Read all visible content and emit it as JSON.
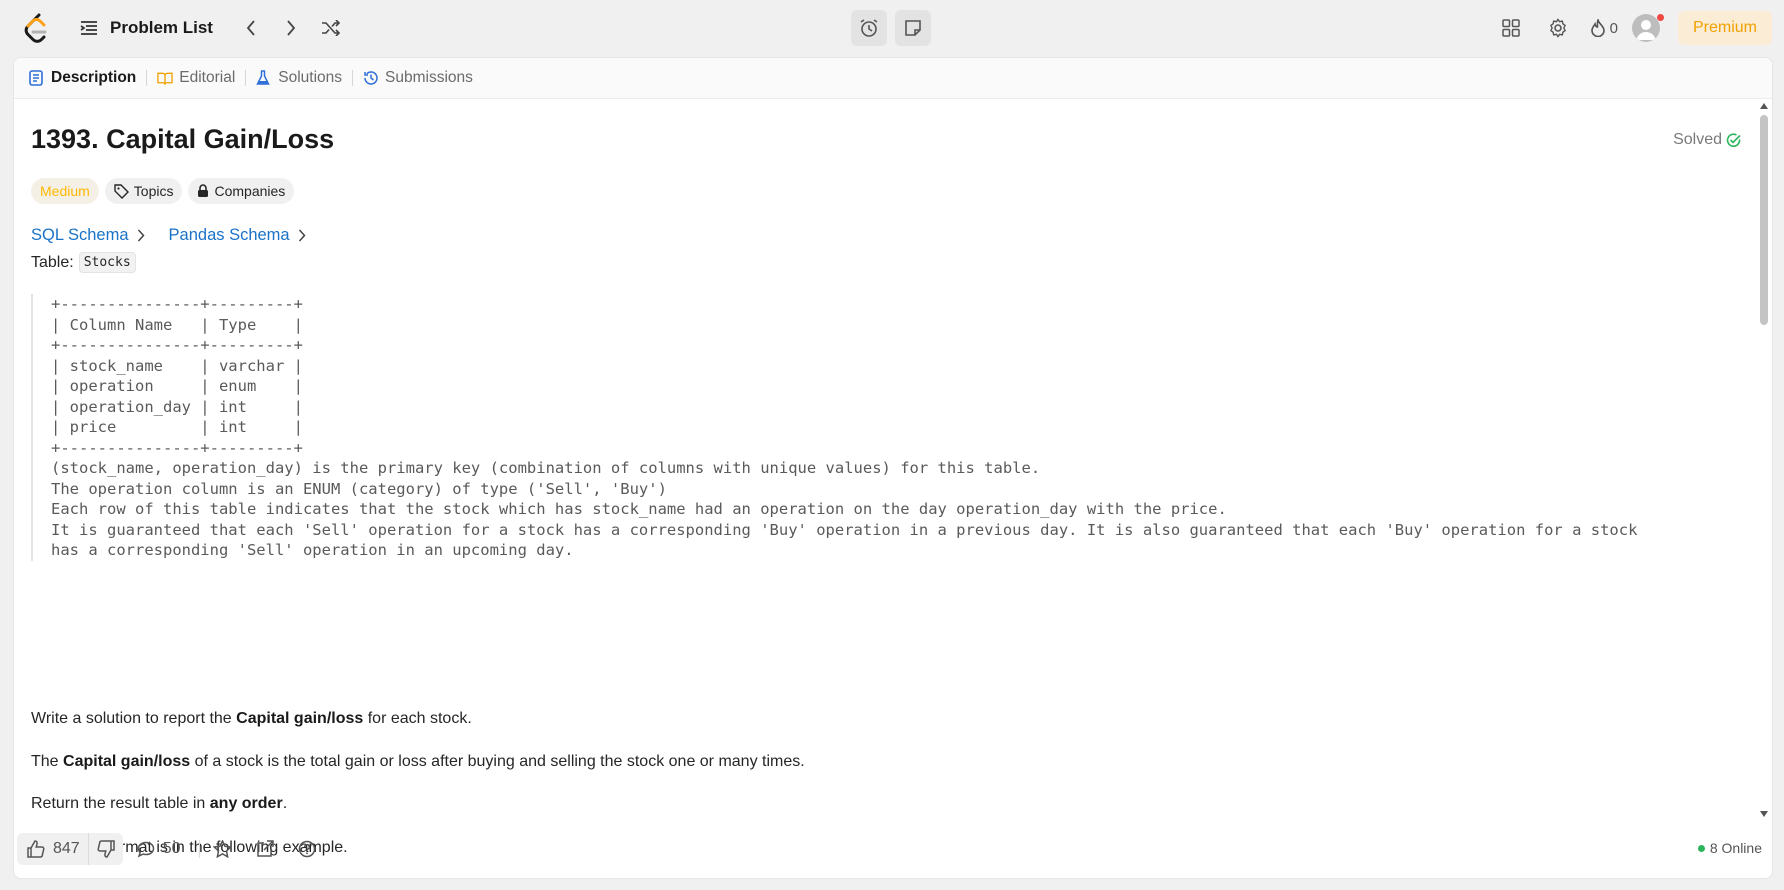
{
  "nav": {
    "problem_list_label": "Problem List",
    "streak_count": "0",
    "premium_label": "Premium"
  },
  "tabs": [
    {
      "label": "Description"
    },
    {
      "label": "Editorial"
    },
    {
      "label": "Solutions"
    },
    {
      "label": "Submissions"
    }
  ],
  "problem": {
    "title": "1393. Capital Gain/Loss",
    "status": "Solved",
    "difficulty": "Medium",
    "topics_label": "Topics",
    "companies_label": "Companies",
    "sql_schema_label": "SQL Schema",
    "pandas_schema_label": "Pandas Schema",
    "table_prefix": "Table:",
    "table_name": "Stocks",
    "schema_lines": [
      "+---------------+---------+",
      "| Column Name   | Type    |",
      "+---------------+---------+",
      "| stock_name    | varchar |",
      "| operation     | enum    |",
      "| operation_day | int     |",
      "| price         | int     |",
      "+---------------+---------+",
      "(stock_name, operation_day) is the primary key (combination of columns with unique values) for this table.",
      "The operation column is an ENUM (category) of type ('Sell', 'Buy')",
      "Each row of this table indicates that the stock which has stock_name had an operation on the day operation_day with the price.",
      "It is guaranteed that each 'Sell' operation for a stock has a corresponding 'Buy' operation in a previous day. It is also guaranteed that each 'Buy' operation for a stock",
      "has a corresponding 'Sell' operation in an upcoming day."
    ],
    "p1_before": "Write a solution to report the ",
    "p1_bold": "Capital gain/loss",
    "p1_after": " for each stock.",
    "p2_before": "The ",
    "p2_bold": "Capital gain/loss",
    "p2_after": " of a stock is the total gain or loss after buying and selling the stock one or many times.",
    "p3_before": "Return the result table in ",
    "p3_bold": "any order",
    "p3_after": ".",
    "p4": "The result format is in the following example."
  },
  "footer": {
    "likes": "847",
    "comments": "50",
    "online": "8 Online"
  },
  "colors": {
    "accent_premium": "#f0a100",
    "difficulty_medium": "#ffb800",
    "link_blue": "#1a73c7",
    "solved_green": "#2db55d",
    "online_green": "#2db55d"
  }
}
